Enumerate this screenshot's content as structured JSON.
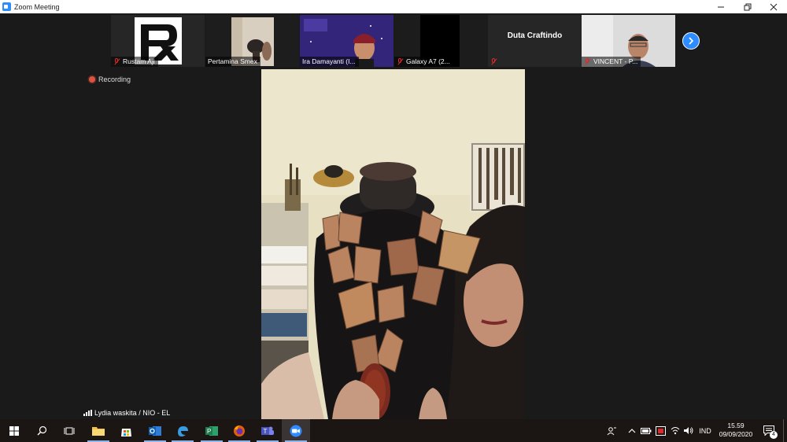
{
  "window": {
    "title": "Zoom Meeting",
    "controls": [
      "minimize",
      "restore",
      "close"
    ]
  },
  "participants": [
    {
      "name": "Rustam Aji",
      "muted": true,
      "kind": "logo"
    },
    {
      "name": "Pertamina Smex",
      "muted": false,
      "kind": "video"
    },
    {
      "name": "Ira Damayanti (I...",
      "muted": false,
      "kind": "video"
    },
    {
      "name": "Galaxy A7 (2...",
      "muted": true,
      "kind": "black"
    },
    {
      "name": "Duta Craftindo",
      "muted": true,
      "kind": "name-only"
    },
    {
      "name": "VINCENT - P...",
      "muted": true,
      "kind": "video"
    }
  ],
  "recording": {
    "label": "Recording"
  },
  "active_speaker": {
    "name": "Lydia waskita / NIO - EL"
  },
  "taskbar": {
    "apps": [
      "start-icon",
      "search-icon",
      "task-view-icon",
      "file-explorer-icon",
      "store-icon",
      "outlook-icon",
      "edge-icon",
      "project-icon",
      "firefox-icon",
      "teams-icon",
      "zoom-icon"
    ],
    "language": "IND",
    "time": "15.59",
    "date": "09/09/2020",
    "notification_count": "4"
  },
  "colors": {
    "zoom_blue": "#2d8cff",
    "recording_red": "#e0533a",
    "muted_red": "#e02828"
  }
}
